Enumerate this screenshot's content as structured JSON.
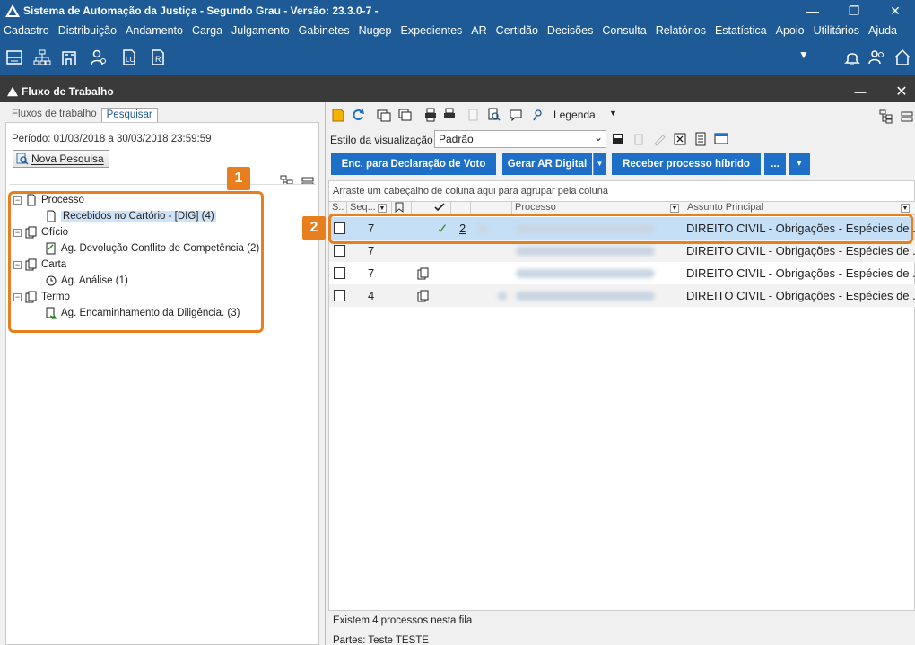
{
  "app": {
    "title": "Sistema de Automação da Justiça - Segundo Grau - Versão: 23.3.0-7 -",
    "window_controls": [
      "minimize-icon",
      "restore-icon",
      "close-icon"
    ]
  },
  "menu": [
    "Cadastro",
    "Distribuição",
    "Andamento",
    "Carga",
    "Julgamento",
    "Gabinetes",
    "Nugep",
    "Expedientes",
    "AR",
    "Certidão",
    "Decisões",
    "Consulta",
    "Relatórios",
    "Estatística",
    "Apoio",
    "Utilitários",
    "Ajuda"
  ],
  "main_toolbar_icons": [
    "inbox-icon",
    "org-chart-icon",
    "building-icon",
    "user-gear-icon",
    "document-lo-icon",
    "document-r-icon"
  ],
  "main_toolbar_right_icons": [
    "dropdown-icon",
    "bell-icon",
    "users-icon",
    "home-icon"
  ],
  "window": {
    "title": "Fluxo de Trabalho"
  },
  "left": {
    "tabs": [
      "Fluxos de trabalho",
      "Pesquisar"
    ],
    "active_tab": "Pesquisar",
    "periodo": "Período: 01/03/2018 a 30/03/2018 23:59:59",
    "nova_pesquisa": "Nova Pesquisa",
    "tree": [
      {
        "label": "Processo",
        "children": [
          {
            "label": "Recebidos no Cartório - [DIG] (4)",
            "selected": true
          }
        ]
      },
      {
        "label": "Ofício",
        "children": [
          {
            "label": "Ag. Devolução Conflito de Competência (2)"
          }
        ]
      },
      {
        "label": "Carta",
        "children": [
          {
            "label": "Ag. Análise (1)"
          }
        ]
      },
      {
        "label": "Termo",
        "children": [
          {
            "label": "Ag. Encaminhamento da Diligência. (3)"
          }
        ]
      }
    ],
    "callout": "1"
  },
  "right": {
    "legenda": "Legenda",
    "estilo_label": "Estilo da visualização",
    "estilo_value": "Padrão",
    "buttons": {
      "enc": "Enc. para Declaração de Voto",
      "gerar": "Gerar AR Digital",
      "receber": "Receber processo híbrido",
      "more": "..."
    },
    "group_hint": "Arraste um cabeçalho de coluna aqui para agrupar pela coluna",
    "columns": [
      "S..",
      "Seq...",
      "",
      "",
      "",
      "",
      "Processo",
      "Assunto Principal"
    ],
    "rows": [
      {
        "seq": "7",
        "check": "✓",
        "num": "2",
        "assunto": "DIREITO CIVIL - Obrigações - Espécies de ...",
        "selected": true
      },
      {
        "seq": "7",
        "check": "",
        "num": "",
        "assunto": "DIREITO CIVIL - Obrigações - Espécies de ..."
      },
      {
        "seq": "7",
        "check": "",
        "num": "",
        "assunto": "DIREITO CIVIL - Obrigações - Espécies de ..."
      },
      {
        "seq": "4",
        "check": "",
        "num": "",
        "assunto": "DIREITO CIVIL - Obrigações - Espécies de ..."
      }
    ],
    "status": "Existem 4 processos nesta fila",
    "partes": "Partes: Teste TESTE",
    "callout": "2"
  },
  "colors": {
    "brand": "#1e5a96",
    "button_blue": "#1e6fc8",
    "callout": "#e87f1e",
    "selection": "#c5dff7"
  }
}
